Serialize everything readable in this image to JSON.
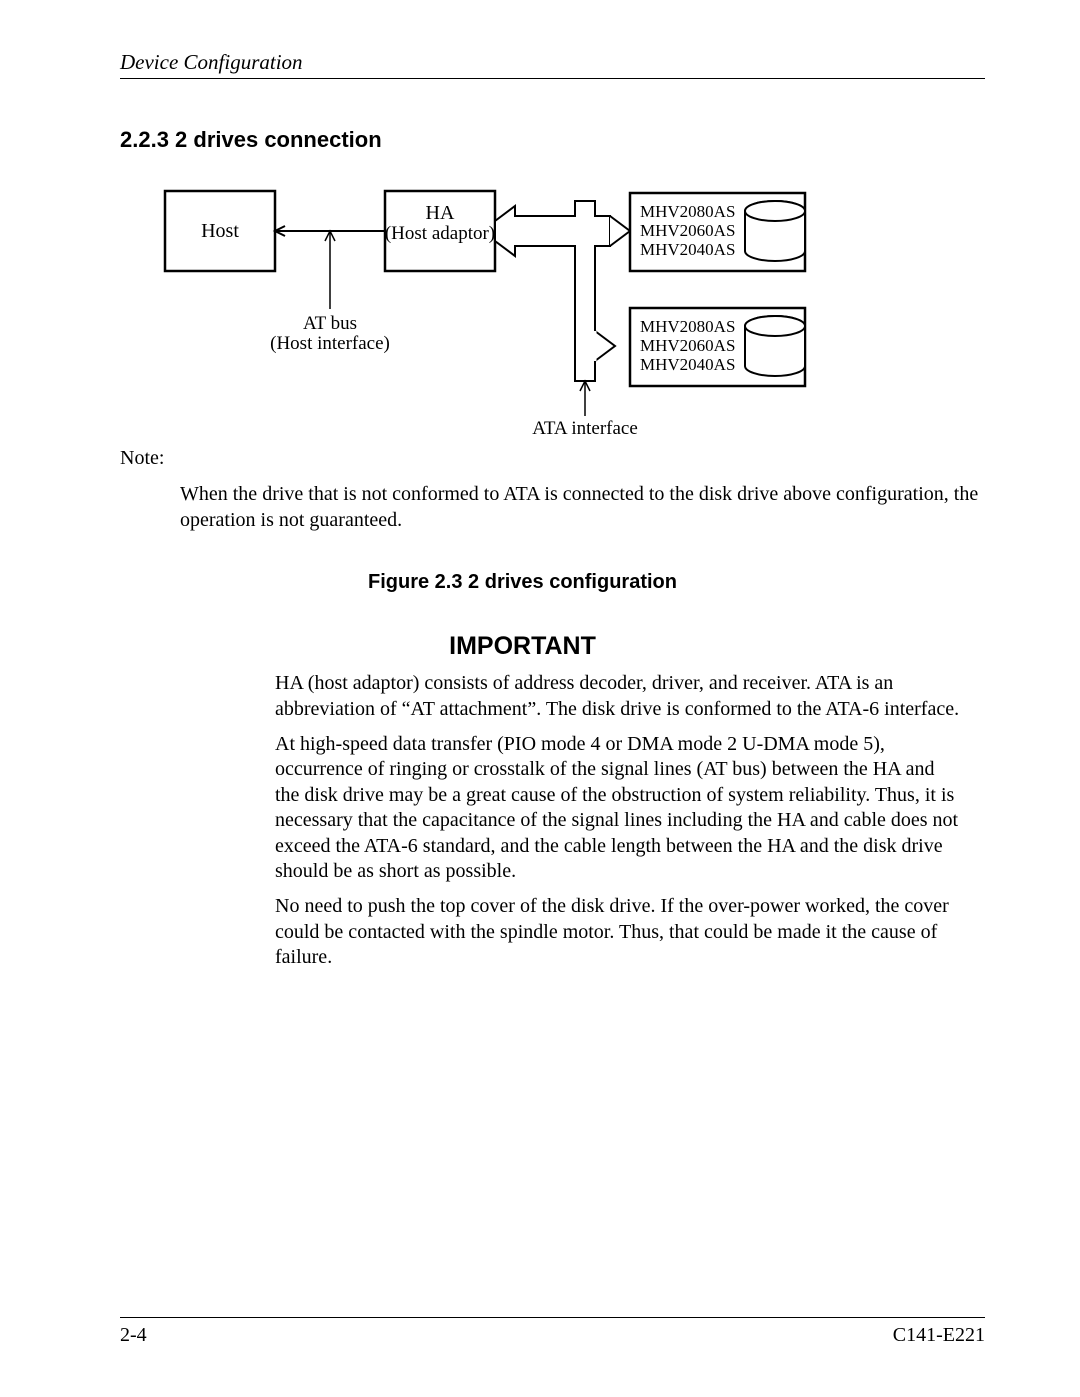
{
  "header": {
    "title": "Device Configuration"
  },
  "section": {
    "heading": "2.2.3  2 drives connection"
  },
  "diagram": {
    "host": "Host",
    "ha_line1": "HA",
    "ha_line2": "(Host adaptor)",
    "atbus_line1": "AT bus",
    "atbus_line2": "(Host interface)",
    "ata_interface": "ATA interface",
    "drive_models": [
      "MHV2080AS",
      "MHV2060AS",
      "MHV2040AS"
    ]
  },
  "note": {
    "label": "Note:",
    "body": "When the drive that is not conformed to ATA is connected to the disk drive above configuration, the operation is not guaranteed."
  },
  "figure": {
    "caption": "Figure 2.3  2 drives configuration"
  },
  "important": {
    "heading": "IMPORTANT",
    "p1": "HA (host adaptor) consists of address decoder, driver, and receiver.  ATA is an abbreviation of “AT attachment”.  The disk drive is conformed to the ATA-6 interface.",
    "p2": "At high-speed data transfer (PIO mode 4 or DMA mode 2 U-DMA mode 5), occurrence of ringing or crosstalk of the signal lines (AT bus) between the HA and the disk drive may be a great cause of the obstruction of system reliability.  Thus, it is necessary that the capacitance of the signal lines including the HA and cable does not exceed the ATA-6 standard, and the cable length between the HA and the disk drive should be as short as possible.",
    "p3": "No need to push the top cover of the disk drive.  If the over-power worked, the cover could be contacted with the spindle motor.  Thus, that could be made it the cause of failure."
  },
  "footer": {
    "page": "2-4",
    "docid": "C141-E221"
  }
}
